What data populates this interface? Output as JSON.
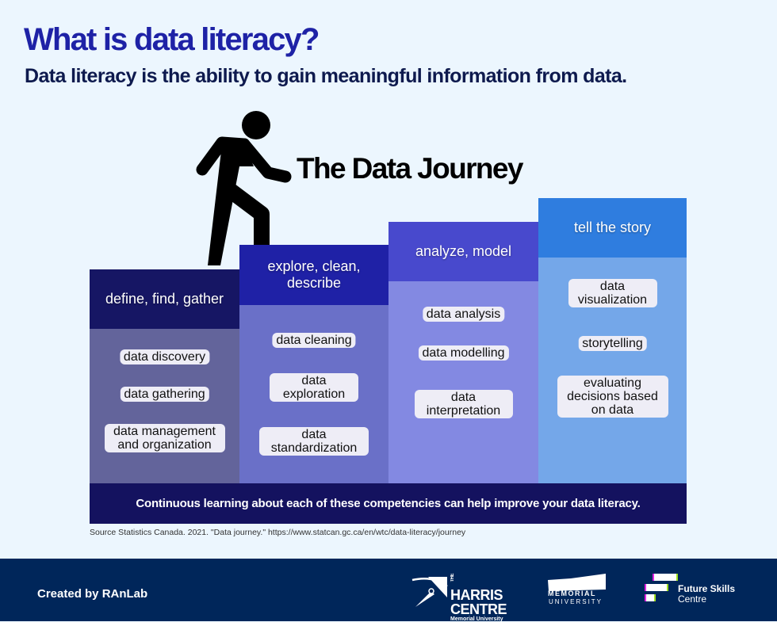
{
  "header": {
    "title": "What is data literacy?",
    "subtitle": "Data literacy is the ability to gain meaningful information from data."
  },
  "journey": {
    "title": "The Data Journey",
    "figure_icon": "walking-person-climbing-stairs-icon",
    "stages": [
      {
        "label": "define, find, gather",
        "color_header": "#161664",
        "color_body": "#63649b",
        "competencies": [
          "data discovery",
          "data gathering",
          "data management and organization"
        ]
      },
      {
        "label": "explore, clean, describe",
        "color_header": "#1f21a6",
        "color_body": "#6a70c8",
        "competencies": [
          "data cleaning",
          "data exploration",
          "data standardization"
        ]
      },
      {
        "label": "analyze, model",
        "color_header": "#4849cd",
        "color_body": "#8389e2",
        "competencies": [
          "data analysis",
          "data modelling",
          "data interpretation"
        ]
      },
      {
        "label": "tell the story",
        "color_header": "#2f7ddf",
        "color_body": "#74a7e9",
        "competencies": [
          "data visualization",
          "storytelling",
          "evaluating decisions based on data"
        ]
      }
    ],
    "banner": "Continuous learning about each of these competencies can help improve your data literacy."
  },
  "source": "Source Statistics Canada. 2021. \"Data journey.\" https://www.statcan.gc.ca/en/wtc/data-literacy/journey",
  "footer": {
    "credit": "Created by RAnLab",
    "logos": {
      "harris": {
        "small": "THE",
        "line1": "HARRIS",
        "line2": "CENTRE",
        "line3": "Memorial University"
      },
      "memorial": {
        "line1": "MEMORIAL",
        "line2": "UNIVERSITY"
      },
      "future_skills": {
        "line1": "Future Skills",
        "line2": "Centre"
      }
    }
  }
}
